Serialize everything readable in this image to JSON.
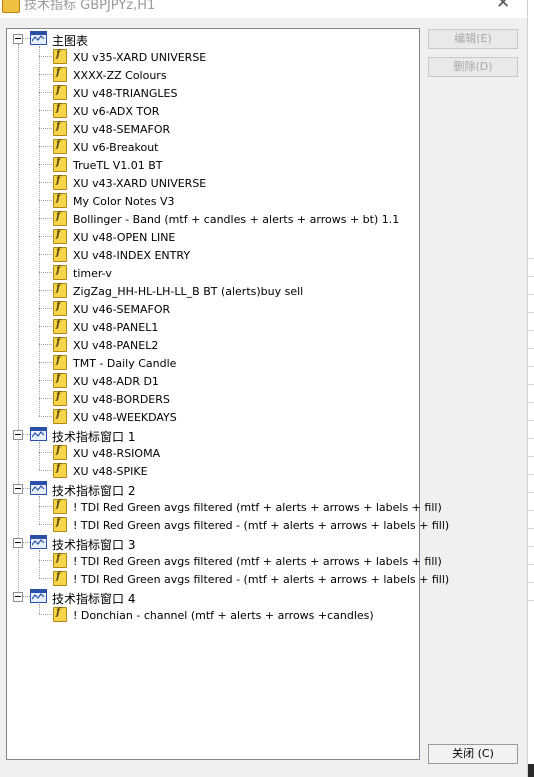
{
  "window": {
    "title": "技术指标 GBPJPYz,H1",
    "close_glyph": "✕"
  },
  "buttons": {
    "edit": "编辑(E)",
    "delete": "删除(D)",
    "close": "关闭 (C)"
  },
  "icons": {
    "folder": "window-chart-icon",
    "indicator": "custom-indicator-icon"
  },
  "tree": [
    {
      "label": "主图表",
      "items": [
        "XU v35-XARD UNIVERSE",
        "XXXX-ZZ Colours",
        "XU v48-TRIANGLES",
        "XU v6-ADX TOR",
        "XU v48-SEMAFOR",
        "XU v6-Breakout",
        "TrueTL V1.01 BT",
        "XU v43-XARD UNIVERSE",
        "My Color Notes V3",
        "Bollinger - Band (mtf + candles + alerts + arrows + bt) 1.1",
        "XU v48-OPEN LINE",
        "XU v48-INDEX ENTRY",
        "timer-v",
        "ZigZag_HH-HL-LH-LL_B BT (alerts)buy sell",
        "XU v46-SEMAFOR",
        "XU v48-PANEL1",
        "XU v48-PANEL2",
        "TMT - Daily Candle",
        "XU v48-ADR D1",
        "XU v48-BORDERS",
        "XU v48-WEEKDAYS"
      ]
    },
    {
      "label": "技术指标窗口 1",
      "items": [
        "XU v48-RSIOMA",
        "XU v48-SPIKE"
      ]
    },
    {
      "label": "技术指标窗口 2",
      "items": [
        "! TDI Red Green avgs filtered (mtf + alerts + arrows + labels + fill)",
        "! TDI Red Green avgs filtered - (mtf + alerts + arrows + labels + fill)"
      ]
    },
    {
      "label": "技术指标窗口 3",
      "items": [
        "! TDI Red Green avgs filtered (mtf + alerts + arrows + labels + fill)",
        "! TDI Red Green avgs filtered - (mtf + alerts + arrows + labels + fill)"
      ]
    },
    {
      "label": "技术指标窗口 4",
      "items": [
        "! Donchian - channel (mtf + alerts + arrows +candles)"
      ]
    }
  ]
}
